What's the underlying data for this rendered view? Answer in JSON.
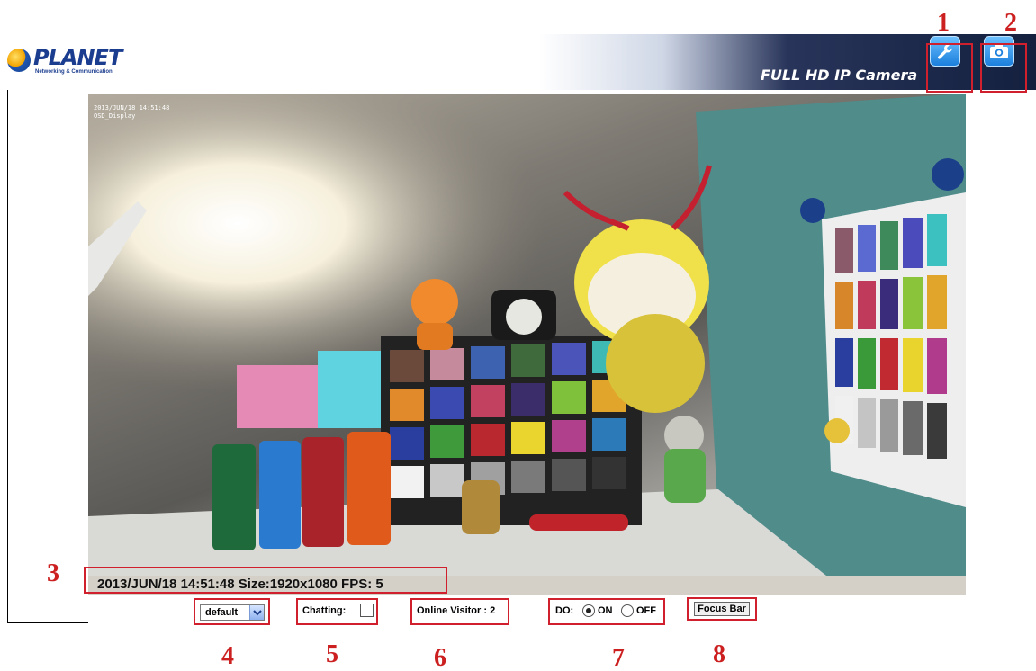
{
  "header": {
    "logo_text": "PLANET",
    "logo_subtitle": "Networking & Communication",
    "product_title": "FULL HD IP Camera",
    "settings_icon": "wrench-icon",
    "snapshot_icon": "camera-icon"
  },
  "video": {
    "osd_line1": "2013/JUN/18 14:51:48",
    "osd_line2": "OSD_Display",
    "status_text": "2013/JUN/18 14:51:48 Size:1920x1080 FPS: 5"
  },
  "controls": {
    "profile_select_value": "default",
    "chatting_label": "Chatting:",
    "online_visitor_label": "Online Visitor : 2",
    "do_label": "DO:",
    "do_on_label": "ON",
    "do_off_label": "OFF",
    "focus_button_label": "Focus Bar"
  },
  "callouts": [
    "1",
    "2",
    "3",
    "4",
    "5",
    "6",
    "7",
    "8"
  ],
  "colors": {
    "callout_red": "#d0202e",
    "header_dark": "#14203e",
    "icon_blue": "#1b7fdc"
  }
}
